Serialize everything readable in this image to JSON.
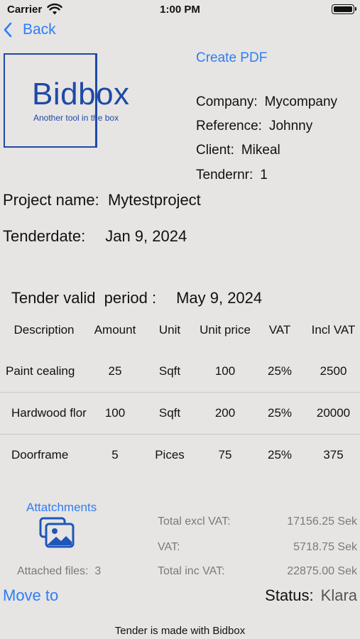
{
  "status_bar": {
    "carrier": "Carrier",
    "time": "1:00 PM"
  },
  "nav": {
    "back_label": "Back"
  },
  "logo": {
    "wordmark": "Bidbox",
    "tagline": "Another tool in the box",
    "color": "#1f49a6"
  },
  "actions": {
    "create_pdf": "Create PDF"
  },
  "meta": [
    {
      "label": "Company:",
      "value": "Mycompany"
    },
    {
      "label": "Reference:",
      "value": "Johnny"
    },
    {
      "label": "Client:",
      "value": "Mikeal"
    },
    {
      "label": "Tendernr:",
      "value": "1"
    }
  ],
  "project": {
    "label": "Project name:",
    "value": "Mytestproject"
  },
  "tender_date": {
    "label": "Tenderdate:",
    "value": "Jan 9, 2024"
  },
  "valid_period": {
    "label": "Tender valid  period :",
    "value": "May 9, 2024"
  },
  "table": {
    "headers": [
      "Description",
      "Amount",
      "Unit",
      "Unit price",
      "VAT",
      "Incl VAT"
    ],
    "rows": [
      [
        "Paint cealing",
        "25",
        "Sqft",
        "100",
        "25%",
        "2500"
      ],
      [
        "Hardwood flor",
        "100",
        "Sqft",
        "200",
        "25%",
        "20000"
      ],
      [
        "Doorframe",
        "5",
        "Pices",
        "75",
        "25%",
        "375"
      ]
    ]
  },
  "attachments": {
    "label": "Attatchments",
    "files_label": "Attached files:",
    "files_count": "3"
  },
  "totals": [
    {
      "label": "Total excl VAT:",
      "value": "17156.25 Sek"
    },
    {
      "label": "VAT:",
      "value": "5718.75 Sek"
    },
    {
      "label": "Total inc VAT:",
      "value": "22875.00 Sek"
    }
  ],
  "bottom": {
    "move_to": "Move to",
    "status_label": "Status:",
    "status_value": "Klara"
  },
  "footer": "Tender is made with Bidbox",
  "colors": {
    "accent": "#2f7cf6",
    "background": "#e6e5e3"
  }
}
